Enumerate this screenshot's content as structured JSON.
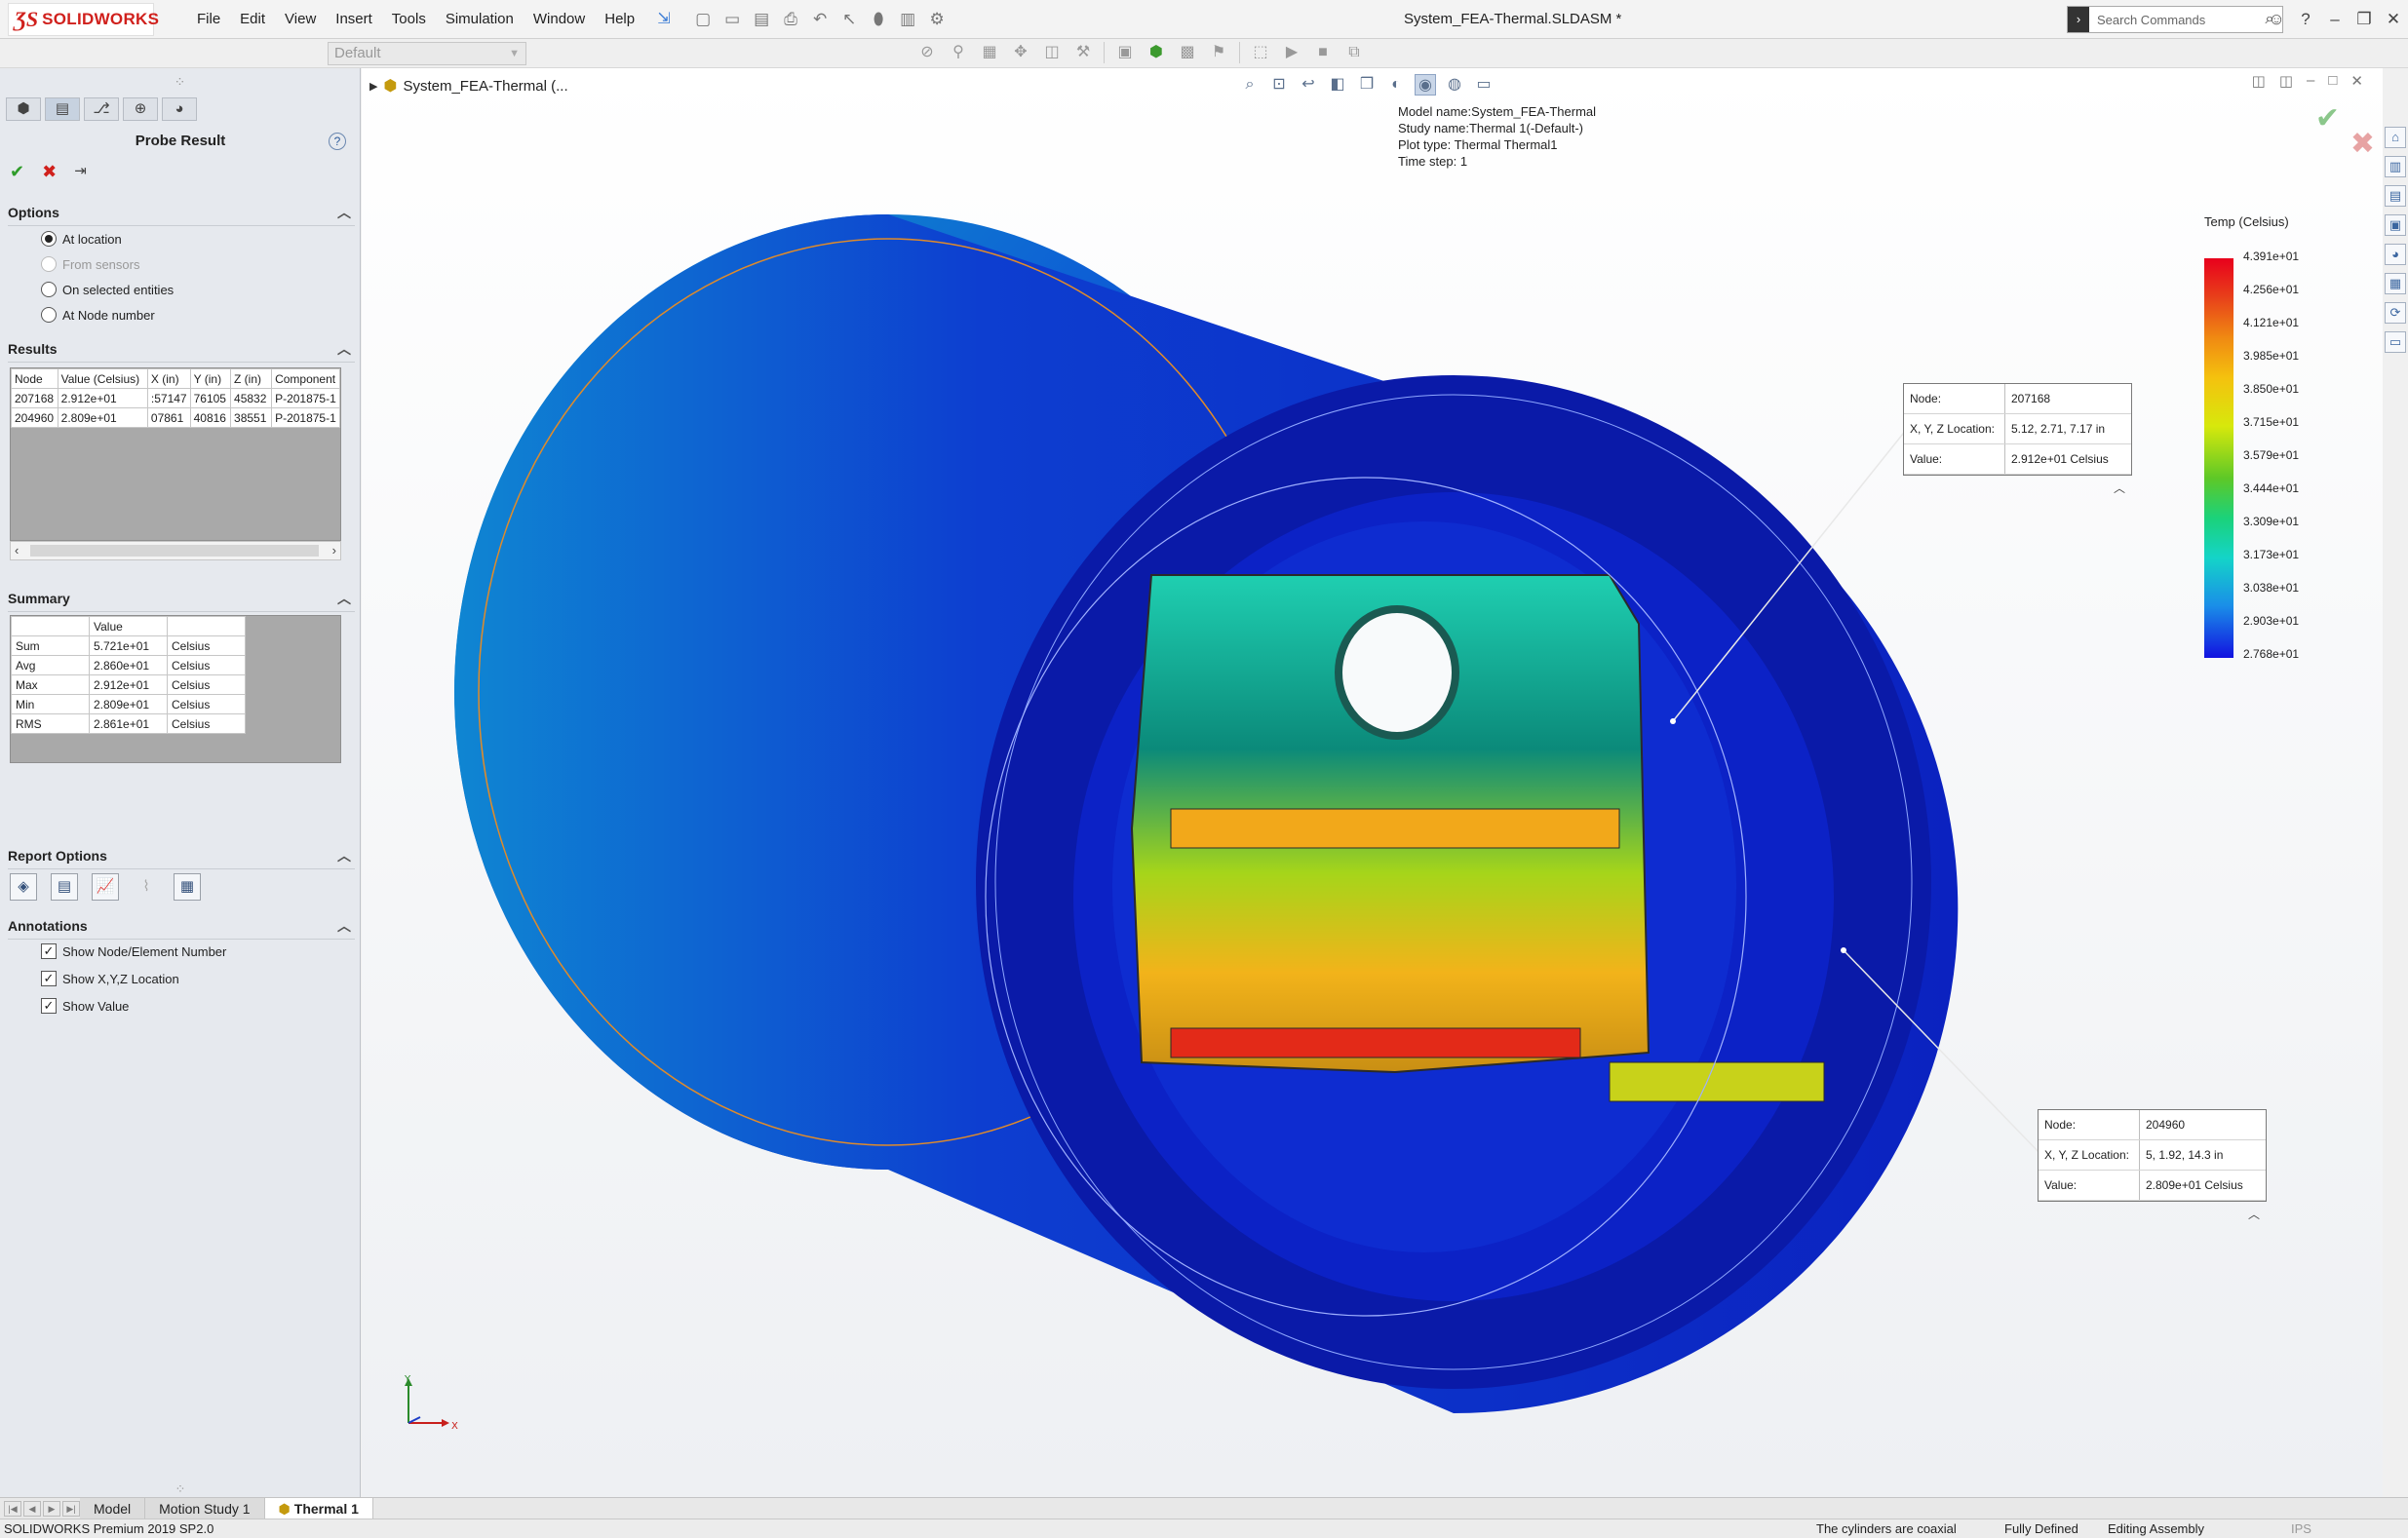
{
  "app": {
    "brand": "SOLIDWORKS",
    "document_title": "System_FEA-Thermal.SLDASM *",
    "menu": [
      "File",
      "Edit",
      "View",
      "Insert",
      "Tools",
      "Simulation",
      "Window",
      "Help"
    ],
    "search_placeholder": "Search Commands",
    "configuration": "Default"
  },
  "property_manager": {
    "title": "Probe Result",
    "options": {
      "header": "Options",
      "items": [
        {
          "label": "At location",
          "selected": true,
          "enabled": true
        },
        {
          "label": "From sensors",
          "selected": false,
          "enabled": false
        },
        {
          "label": "On selected entities",
          "selected": false,
          "enabled": true
        },
        {
          "label": "At Node number",
          "selected": false,
          "enabled": true
        }
      ]
    },
    "results": {
      "header": "Results",
      "columns": [
        "Node",
        "Value (Celsius)",
        "X (in)",
        "Y (in)",
        "Z (in)",
        "Component"
      ],
      "rows": [
        [
          "207168",
          "2.912e+01",
          ":57147",
          "76105",
          "45832",
          "P-201875-1"
        ],
        [
          "204960",
          "2.809e+01",
          "07861",
          "40816",
          "38551",
          "P-201875-1"
        ]
      ]
    },
    "summary": {
      "header": "Summary",
      "columns": [
        "",
        "Value",
        ""
      ],
      "rows": [
        [
          "Sum",
          "5.721e+01",
          "Celsius"
        ],
        [
          "Avg",
          "2.860e+01",
          "Celsius"
        ],
        [
          "Max",
          "2.912e+01",
          "Celsius"
        ],
        [
          "Min",
          "2.809e+01",
          "Celsius"
        ],
        [
          "RMS",
          "2.861e+01",
          "Celsius"
        ]
      ]
    },
    "report_options": {
      "header": "Report Options"
    },
    "annotations": {
      "header": "Annotations",
      "items": [
        {
          "label": "Show Node/Element Number",
          "checked": true
        },
        {
          "label": "Show X,Y,Z Location",
          "checked": true
        },
        {
          "label": "Show Value",
          "checked": true
        }
      ]
    }
  },
  "viewport": {
    "tree_label": "System_FEA-Thermal  (...",
    "study_info": {
      "model_name": "Model name:System_FEA-Thermal",
      "study_name": "Study name:Thermal 1(-Default-)",
      "plot_type": "Plot type: Thermal Thermal1",
      "time_step": "Time step: 1"
    },
    "legend": {
      "title": "Temp (Celsius)",
      "labels": [
        "4.391e+01",
        "4.256e+01",
        "4.121e+01",
        "3.985e+01",
        "3.850e+01",
        "3.715e+01",
        "3.579e+01",
        "3.444e+01",
        "3.309e+01",
        "3.173e+01",
        "3.038e+01",
        "2.903e+01",
        "2.768e+01"
      ],
      "max_color": "#e8001c",
      "min_color": "#1212e0"
    },
    "probes": [
      {
        "node_label": "Node:",
        "node": "207168",
        "loc_label": "X, Y, Z Location:",
        "loc": "5.12, 2.71, 7.17 in",
        "val_label": "Value:",
        "val": "2.912e+01  Celsius"
      },
      {
        "node_label": "Node:",
        "node": "204960",
        "loc_label": "X, Y, Z Location:",
        "loc": "5, 1.92, 14.3 in",
        "val_label": "Value:",
        "val": "2.809e+01  Celsius"
      }
    ]
  },
  "bottom_tabs": [
    "Model",
    "Motion Study 1",
    "Thermal 1"
  ],
  "status": {
    "left": "SOLIDWORKS Premium 2019 SP2.0",
    "message": "The cylinders are coaxial",
    "state": "Fully Defined",
    "mode": "Editing Assembly",
    "units": "IPS"
  }
}
